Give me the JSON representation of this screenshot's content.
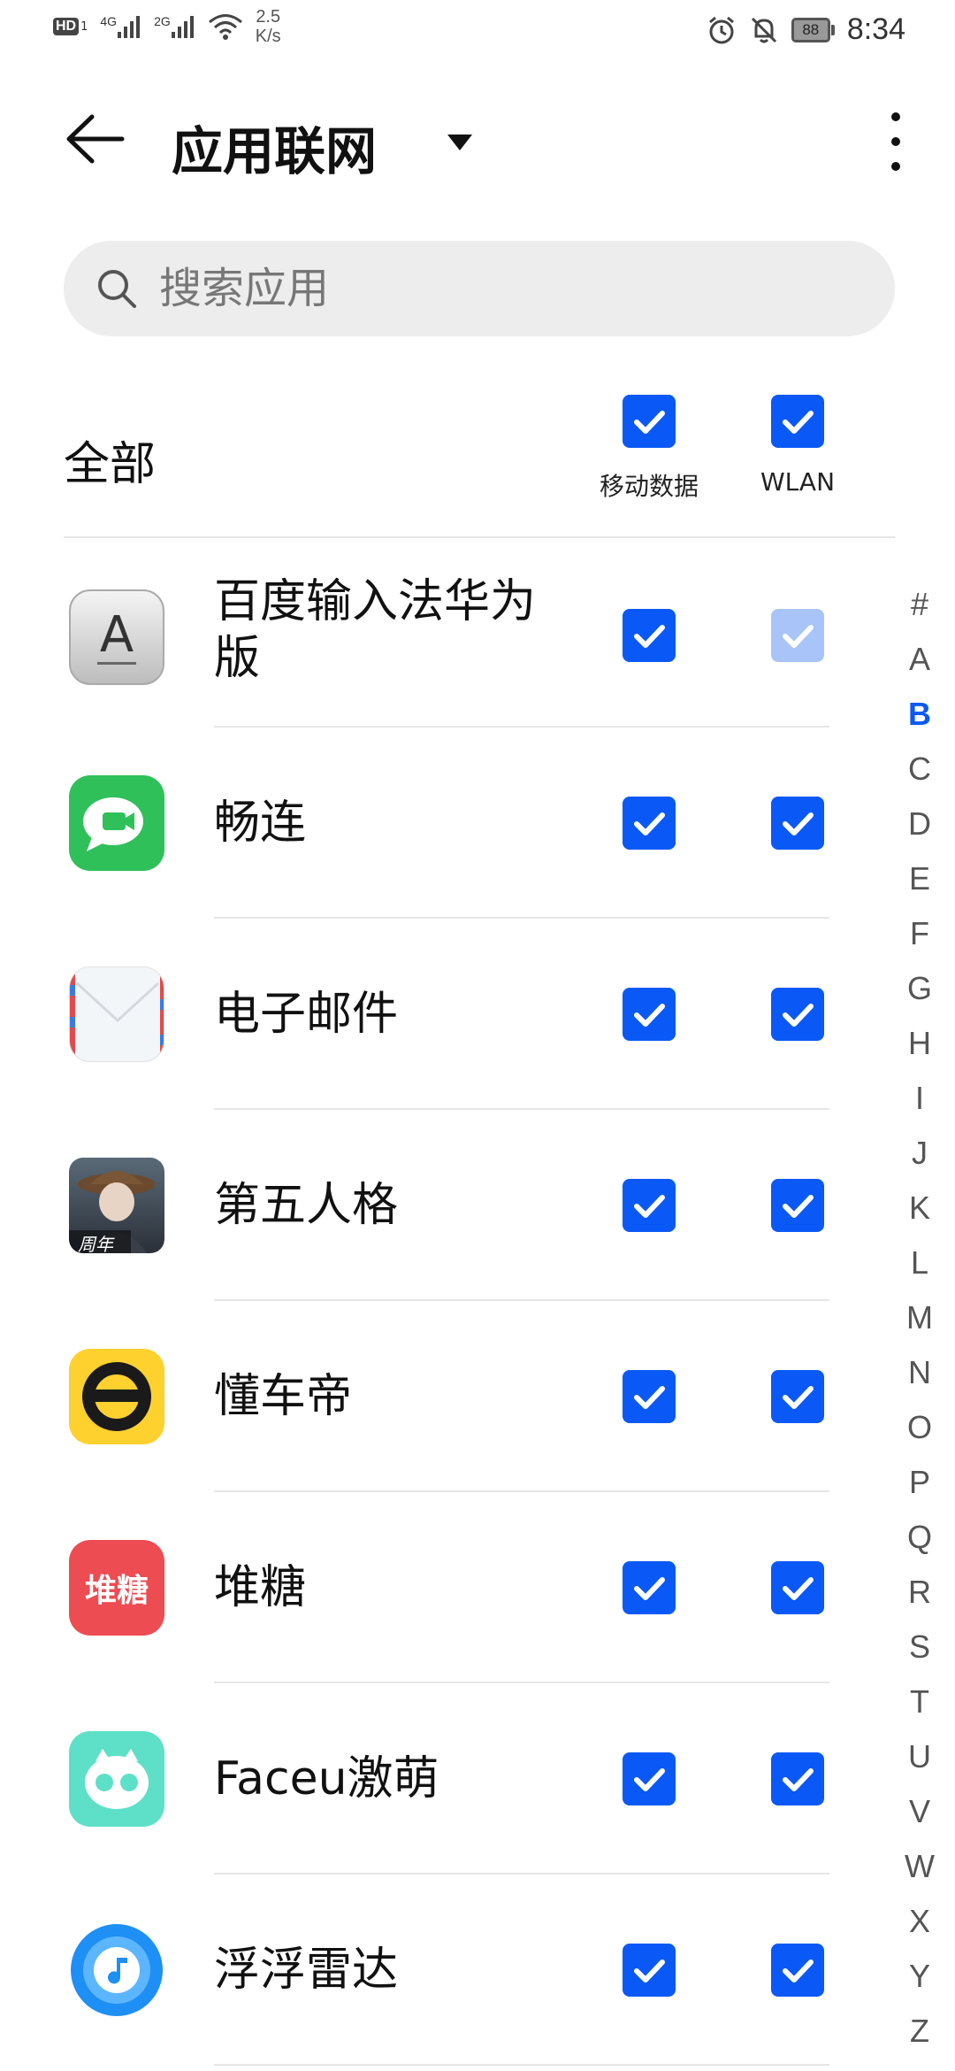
{
  "status_bar": {
    "hd_label": "HD",
    "hd_sim": "1",
    "sim1_net": "4G",
    "sim2_net": "2G",
    "speed_value": "2.5",
    "speed_unit": "K/s",
    "battery": "88",
    "time": "8:34",
    "icons": [
      "alarm-icon",
      "mute-icon"
    ]
  },
  "header": {
    "title": "应用联网"
  },
  "search": {
    "placeholder": "搜索应用"
  },
  "columns": {
    "all_label": "全部",
    "mobile_label": "移动数据",
    "wlan_label": "WLAN",
    "all_mobile_checked": true,
    "all_wlan_checked": true
  },
  "apps": [
    {
      "name": "百度输入法华为版",
      "icon": "baidu-input-icon",
      "mobile": true,
      "wlan": true,
      "wlan_disabled": true
    },
    {
      "name": "畅连",
      "icon": "changlian-icon",
      "mobile": true,
      "wlan": true
    },
    {
      "name": "电子邮件",
      "icon": "email-icon",
      "mobile": true,
      "wlan": true
    },
    {
      "name": "第五人格",
      "icon": "identity-v-icon",
      "badge": "周年",
      "mobile": true,
      "wlan": true
    },
    {
      "name": "懂车帝",
      "icon": "dongchedi-icon",
      "mobile": true,
      "wlan": true
    },
    {
      "name": "堆糖",
      "icon": "duitang-icon",
      "icon_text": "堆糖",
      "mobile": true,
      "wlan": true
    },
    {
      "name": "Faceu激萌",
      "icon": "faceu-icon",
      "mobile": true,
      "wlan": true
    },
    {
      "name": "浮浮雷达",
      "icon": "fufu-radar-icon",
      "mobile": true,
      "wlan": true
    }
  ],
  "index_bar": {
    "letters": [
      "#",
      "A",
      "B",
      "C",
      "D",
      "E",
      "F",
      "G",
      "H",
      "I",
      "J",
      "K",
      "L",
      "M",
      "N",
      "O",
      "P",
      "Q",
      "R",
      "S",
      "T",
      "U",
      "V",
      "W",
      "X",
      "Y",
      "Z"
    ],
    "active": "B"
  },
  "colors": {
    "accent": "#0a59f7",
    "accent_disabled": "#a8c4f9",
    "search_bg": "#ededed"
  }
}
